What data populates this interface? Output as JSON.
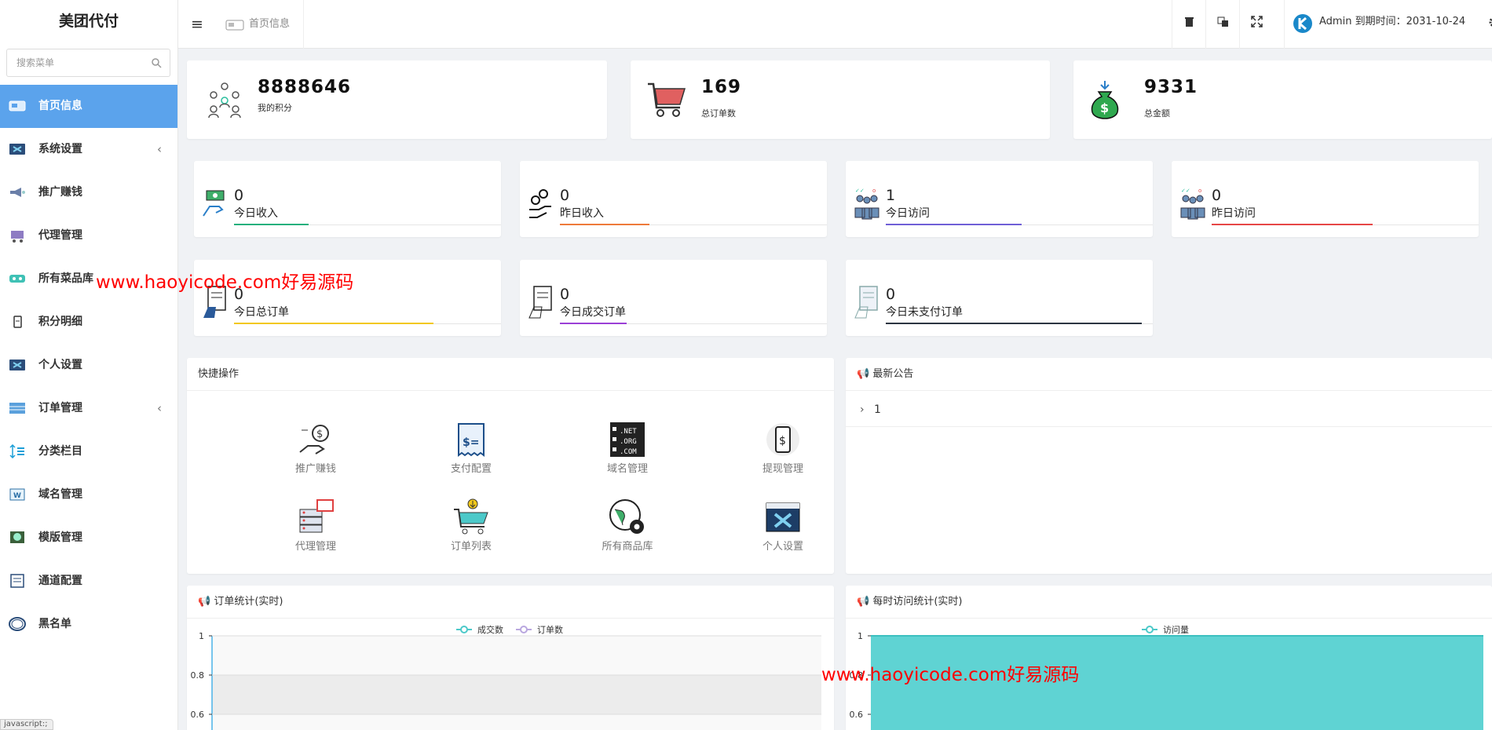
{
  "brand": "美团代付",
  "search": {
    "placeholder": "搜索菜单"
  },
  "menu": [
    {
      "label": "首页信息",
      "icon": "dashboard-icon",
      "active": true
    },
    {
      "label": "系统设置",
      "icon": "settings-panel-icon",
      "arrow": "‹"
    },
    {
      "label": "推广赚钱",
      "icon": "megaphone-icon"
    },
    {
      "label": "代理管理",
      "icon": "agent-cart-icon"
    },
    {
      "label": "所有菜品库",
      "icon": "food-library-icon"
    },
    {
      "label": "积分明细",
      "icon": "points-clipboard-icon"
    },
    {
      "label": "个人设置",
      "icon": "profile-settings-icon"
    },
    {
      "label": "订单管理",
      "icon": "order-table-icon",
      "arrow": "‹"
    },
    {
      "label": "分类栏目",
      "icon": "category-list-icon"
    },
    {
      "label": "域名管理",
      "icon": "domain-icon"
    },
    {
      "label": "模版管理",
      "icon": "template-icon"
    },
    {
      "label": "通道配置",
      "icon": "channel-config-icon"
    },
    {
      "label": "黑名单",
      "icon": "blacklist-ring-icon"
    }
  ],
  "status_bar": "javascript:;",
  "header": {
    "menu_toggle": "≡",
    "breadcrumb": "首页信息",
    "user": "Admin 到期时间：2031-10-24"
  },
  "stats_big": [
    {
      "value": "8888646",
      "label": "我的积分",
      "icon": "team-network-icon"
    },
    {
      "value": "169",
      "label": "总订单数",
      "icon": "shopping-cart-icon"
    },
    {
      "value": "9331",
      "label": "总金额",
      "icon": "money-bag-icon"
    }
  ],
  "stats_small": [
    {
      "value": "0",
      "label": "今日收入",
      "icon": "income-hand-icon",
      "color": "#22b07d",
      "progress": 0.29
    },
    {
      "value": "0",
      "label": "昨日收入",
      "icon": "coins-hand-icon",
      "color": "#ee7a3a",
      "progress": 0.35
    },
    {
      "value": "1",
      "label": "今日访问",
      "icon": "visitors-icon",
      "color": "#6f5fd6",
      "progress": 0.53
    },
    {
      "value": "0",
      "label": "昨日访问",
      "icon": "visitors-icon",
      "color": "#e64646",
      "progress": 0.63
    },
    {
      "value": "0",
      "label": "今日总订单",
      "icon": "order-doc-icon",
      "color": "#f2c81a",
      "progress": 0.78
    },
    {
      "value": "0",
      "label": "今日成交订单",
      "icon": "order-doc-icon",
      "color": "#9b3fd6",
      "progress": 0.26
    },
    {
      "value": "0",
      "label": "今日未支付订单",
      "icon": "unpaid-doc-icon",
      "color": "#2c3542",
      "progress": 1.0
    }
  ],
  "quick": {
    "title": "快捷操作",
    "items": [
      {
        "label": "推广赚钱",
        "icon": "money-hand-icon"
      },
      {
        "label": "支付配置",
        "icon": "receipt-icon"
      },
      {
        "label": "域名管理",
        "icon": "net-org-com-icon"
      },
      {
        "label": "提现管理",
        "icon": "phone-dollar-icon"
      },
      {
        "label": "代理管理",
        "icon": "server-monitor-icon"
      },
      {
        "label": "订单列表",
        "icon": "cart-download-icon"
      },
      {
        "label": "所有商品库",
        "icon": "globe-gear-icon"
      },
      {
        "label": "个人设置",
        "icon": "browser-tools-icon"
      }
    ]
  },
  "notice": {
    "title": "最新公告",
    "items": [
      "1"
    ]
  },
  "order_panel_title": "订单统计(实时)",
  "visit_panel_title": "每时访问统计(实时)",
  "watermark": "www.haoyicode.com好易源码",
  "colors": {
    "accent": "#5ba3ec",
    "teal": "#4cc9c9",
    "violet": "#b9a7df"
  },
  "chart_data": [
    {
      "type": "line",
      "series": [
        {
          "name": "成交数"
        },
        {
          "name": "订单数"
        }
      ],
      "y_ticks": [
        "1",
        "0.8",
        "0.6"
      ],
      "ylim": [
        0,
        1
      ],
      "legend": "top-center"
    },
    {
      "type": "area",
      "series": [
        {
          "name": "访问量"
        }
      ],
      "y_ticks": [
        "1",
        "0.8",
        "0.6"
      ],
      "ylim": [
        0,
        1
      ],
      "legend": "top-center"
    }
  ]
}
